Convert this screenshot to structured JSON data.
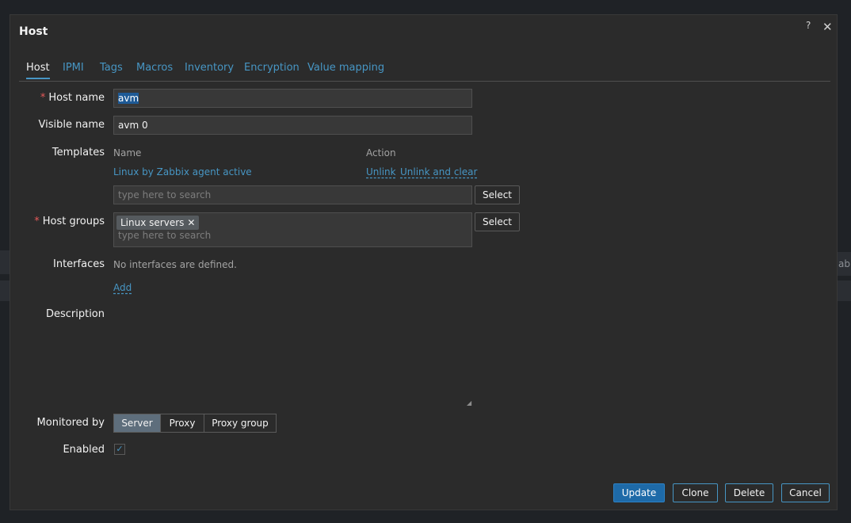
{
  "dialog": {
    "title": "Host",
    "help_glyph": "?",
    "close_glyph": "✕"
  },
  "tabs": [
    "Host",
    "IPMI",
    "Tags",
    "Macros",
    "Inventory",
    "Encryption",
    "Value mapping"
  ],
  "form": {
    "host_name": {
      "label": "Host name",
      "value": "avm"
    },
    "visible_name": {
      "label": "Visible name",
      "value": "avm 0"
    },
    "templates": {
      "label": "Templates",
      "col_name": "Name",
      "col_action": "Action",
      "linked": "Linux by Zabbix agent active",
      "unlink": "Unlink",
      "unlink_clear": "Unlink and clear",
      "search_placeholder": "type here to search",
      "select": "Select"
    },
    "host_groups": {
      "label": "Host groups",
      "chip": "Linux servers",
      "chip_remove": "✕",
      "search_placeholder": "type here to search",
      "select": "Select"
    },
    "interfaces": {
      "label": "Interfaces",
      "empty": "No interfaces are defined.",
      "add": "Add"
    },
    "description": {
      "label": "Description",
      "value": ""
    },
    "monitored_by": {
      "label": "Monitored by",
      "options": [
        "Server",
        "Proxy",
        "Proxy group"
      ],
      "selected": "Server"
    },
    "enabled": {
      "label": "Enabled",
      "checked": true,
      "check_glyph": "✓"
    }
  },
  "footer": {
    "update": "Update",
    "clone": "Clone",
    "delete": "Delete",
    "cancel": "Cancel"
  },
  "background": {
    "fragment": "ab"
  },
  "colors": {
    "accent": "#4796c4",
    "primary_button": "#1e6aa8",
    "required": "#e45959"
  }
}
